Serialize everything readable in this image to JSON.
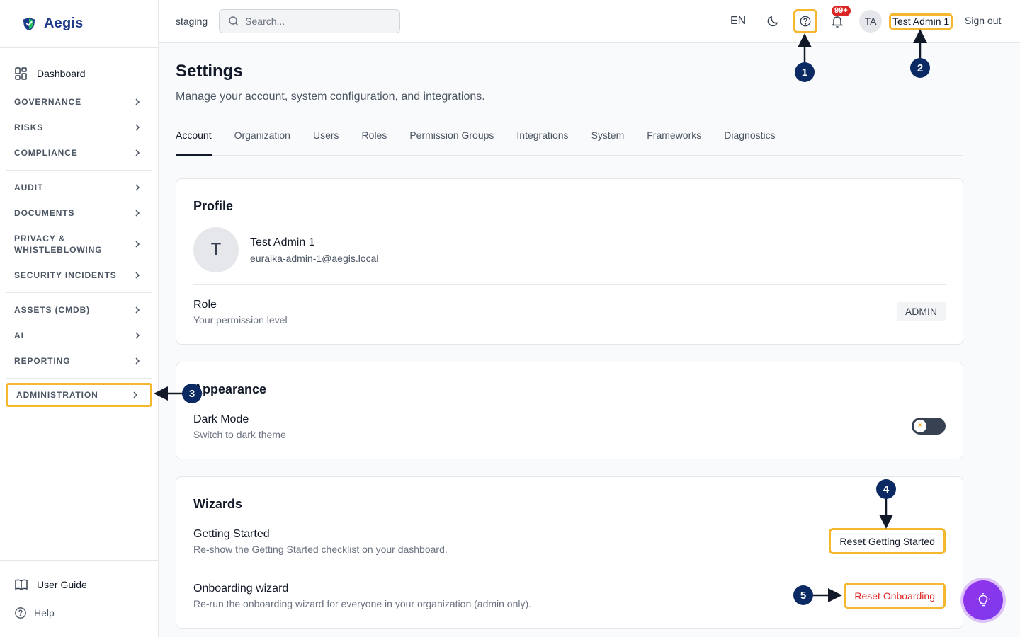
{
  "brand": {
    "name": "Aegis",
    "accent": "#1e3a8a",
    "highlight": "#f5b72e"
  },
  "sidebar": {
    "dashboard": "Dashboard",
    "groups": [
      [
        {
          "label": "GOVERNANCE"
        },
        {
          "label": "RISKS"
        },
        {
          "label": "COMPLIANCE"
        }
      ],
      [
        {
          "label": "AUDIT"
        },
        {
          "label": "DOCUMENTS"
        },
        {
          "label": "PRIVACY & WHISTLEBLOWING"
        },
        {
          "label": "SECURITY INCIDENTS"
        }
      ],
      [
        {
          "label": "ASSETS (CMDB)"
        },
        {
          "label": "AI"
        },
        {
          "label": "REPORTING"
        }
      ]
    ],
    "active_item": "ADMINISTRATION",
    "bottom": {
      "user_guide": "User Guide",
      "help": "Help"
    }
  },
  "header": {
    "environment": "staging",
    "search_placeholder": "Search...",
    "language": "EN",
    "notifications_badge": "99+",
    "user_initials": "TA",
    "user_name": "Test Admin 1",
    "sign_out": "Sign out"
  },
  "page": {
    "title": "Settings",
    "subtitle": "Manage your account, system configuration, and integrations.",
    "tabs": [
      "Account",
      "Organization",
      "Users",
      "Roles",
      "Permission Groups",
      "Integrations",
      "System",
      "Frameworks",
      "Diagnostics"
    ],
    "active_tab": "Account"
  },
  "profile": {
    "title": "Profile",
    "initial": "T",
    "name": "Test Admin 1",
    "email": "euraika-admin-1@aegis.local",
    "role_label": "Role",
    "role_sub": "Your permission level",
    "role_value": "ADMIN"
  },
  "appearance": {
    "title": "Appearance",
    "dark_mode_label": "Dark Mode",
    "dark_mode_sub": "Switch to dark theme",
    "toggle_icon": "sun-icon"
  },
  "wizards": {
    "title": "Wizards",
    "getting_started_label": "Getting Started",
    "getting_started_sub": "Re-show the Getting Started checklist on your dashboard.",
    "getting_started_button": "Reset Getting Started",
    "onboarding_label": "Onboarding wizard",
    "onboarding_sub": "Re-run the onboarding wizard for everyone in your organization (admin only).",
    "onboarding_button": "Reset Onboarding"
  },
  "callouts": [
    "1",
    "2",
    "3",
    "4",
    "5"
  ]
}
